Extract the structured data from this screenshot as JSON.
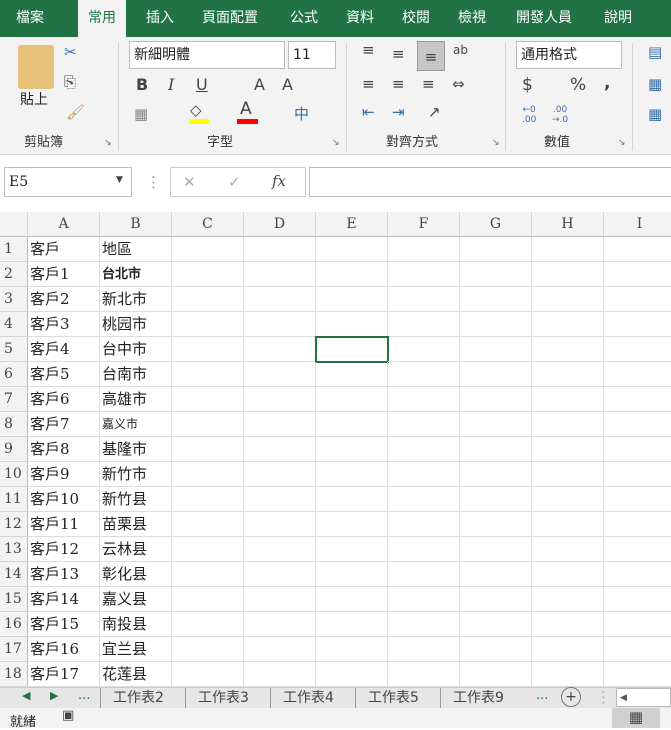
{
  "ribbon_tabs": [
    "檔案",
    "常用",
    "插入",
    "頁面配置",
    "公式",
    "資料",
    "校閱",
    "檢視",
    "開發人員",
    "說明"
  ],
  "active_tab": "常用",
  "clipboard": {
    "paste_label": "貼上",
    "group_label": "剪貼簿"
  },
  "font": {
    "name": "新細明體",
    "size": "11",
    "group_label": "字型",
    "bold": "B",
    "italic": "I",
    "underline": "U",
    "grow": "A",
    "shrink": "A",
    "font_color": "A",
    "phonetic": "中",
    "fill_color": "#ffff00",
    "text_color": "#ff0000"
  },
  "alignment": {
    "group_label": "對齊方式",
    "wrap": "ab"
  },
  "number": {
    "format": "通用格式",
    "group_label": "數值",
    "currency": "$",
    "percent": "%",
    "comma": ","
  },
  "formula_bar": {
    "name_box": "E5",
    "cancel": "✕",
    "enter": "✓",
    "fx": "fx",
    "value": ""
  },
  "columns": [
    "A",
    "B",
    "C",
    "D",
    "E",
    "F",
    "G",
    "H",
    "I"
  ],
  "rows": [
    [
      "客戶",
      "地區"
    ],
    [
      "客戶1",
      "台北市"
    ],
    [
      "客戶2",
      "新北市"
    ],
    [
      "客戶3",
      "桃园市"
    ],
    [
      "客戶4",
      "台中市"
    ],
    [
      "客戶5",
      "台南市"
    ],
    [
      "客戶6",
      "高雄市"
    ],
    [
      "客戶7",
      "嘉义市"
    ],
    [
      "客戶8",
      "基隆市"
    ],
    [
      "客戶9",
      "新竹市"
    ],
    [
      "客戶10",
      "新竹县"
    ],
    [
      "客戶11",
      "苗栗县"
    ],
    [
      "客戶12",
      "云林县"
    ],
    [
      "客戶13",
      "彰化县"
    ],
    [
      "客戶14",
      "嘉义县"
    ],
    [
      "客戶15",
      "南投县"
    ],
    [
      "客戶16",
      "宜兰县"
    ],
    [
      "客戶17",
      "花莲县"
    ]
  ],
  "sheet_tabs": [
    "工作表2",
    "工作表3",
    "工作表4",
    "工作表5",
    "工作表9"
  ],
  "sheet_more": "...",
  "status": {
    "ready": "就緒"
  },
  "accent": "#217346"
}
